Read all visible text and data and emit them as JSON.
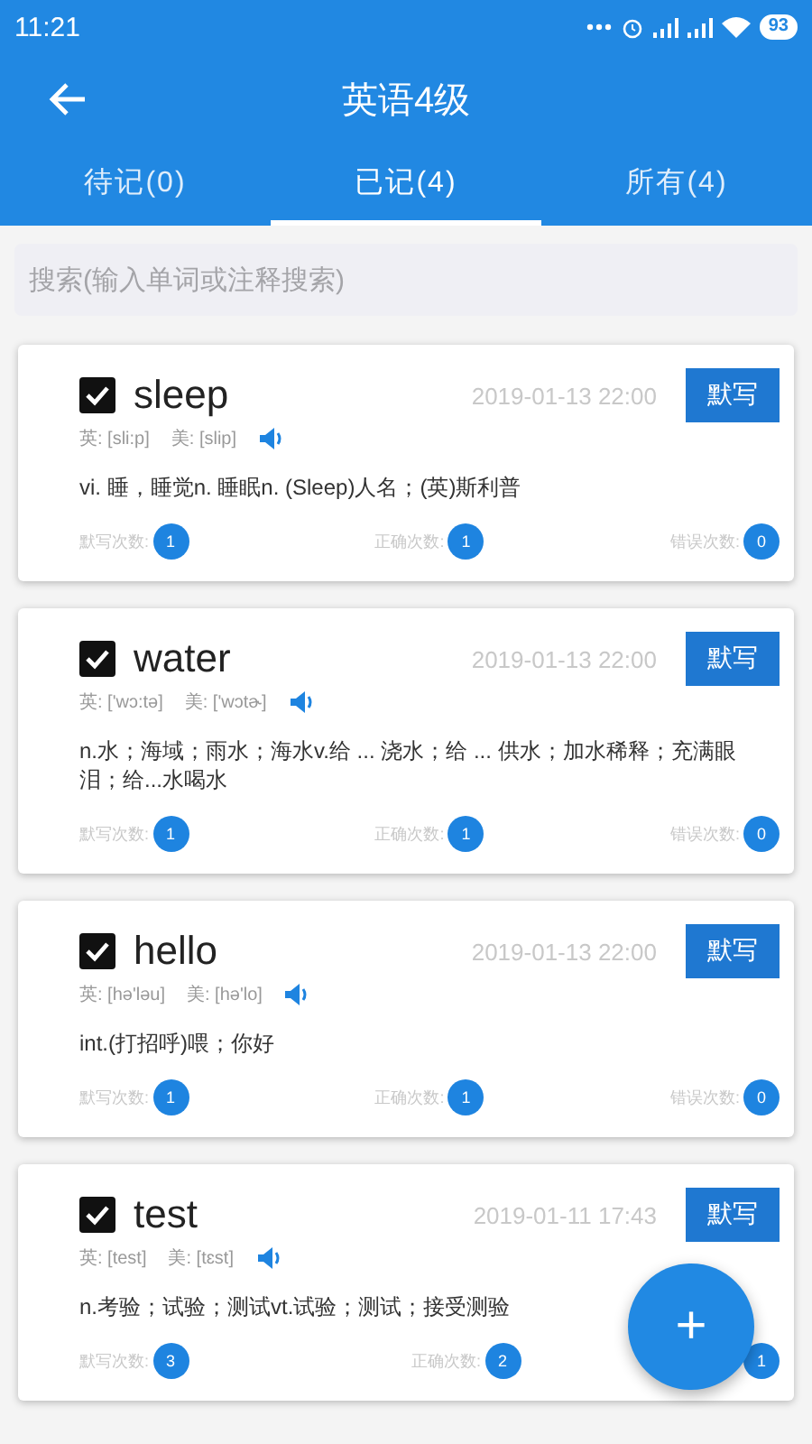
{
  "status_bar": {
    "time": "11:21",
    "battery": "93"
  },
  "toolbar": {
    "title": "英语4级"
  },
  "tabs": [
    {
      "label": "待记(0)",
      "selected": false
    },
    {
      "label": "已记(4)",
      "selected": true
    },
    {
      "label": "所有(4)",
      "selected": false
    }
  ],
  "search": {
    "placeholder": "搜索(输入单词或注释搜索)"
  },
  "cards": [
    {
      "word": "sleep",
      "checked": true,
      "date": "2019-01-13 22:00",
      "button": "默写",
      "uk": "英: [sli:p]",
      "us": "美: [slip]",
      "meaning": "vi. 睡，睡觉n. 睡眠n. (Sleep)人名；(英)斯利普",
      "stats": [
        {
          "label": "默写次数:",
          "value": "1"
        },
        {
          "label": "正确次数:",
          "value": "1"
        },
        {
          "label": "错误次数:",
          "value": "0"
        }
      ]
    },
    {
      "word": "water",
      "checked": true,
      "date": "2019-01-13 22:00",
      "button": "默写",
      "uk": "英: ['wɔ:tə]",
      "us": "美: ['wɔtɚ]",
      "meaning": "n.水；海域；雨水；海水v.给 ... 浇水；给 ... 供水；加水稀释；充满眼泪；给...水喝水",
      "stats": [
        {
          "label": "默写次数:",
          "value": "1"
        },
        {
          "label": "正确次数:",
          "value": "1"
        },
        {
          "label": "错误次数:",
          "value": "0"
        }
      ]
    },
    {
      "word": "hello",
      "checked": true,
      "date": "2019-01-13 22:00",
      "button": "默写",
      "uk": "英: [hə'ləu]",
      "us": "美: [hə'lo]",
      "meaning": "int.(打招呼)喂；你好",
      "stats": [
        {
          "label": "默写次数:",
          "value": "1"
        },
        {
          "label": "正确次数:",
          "value": "1"
        },
        {
          "label": "错误次数:",
          "value": "0"
        }
      ]
    },
    {
      "word": "test",
      "checked": true,
      "date": "2019-01-11 17:43",
      "button": "默写",
      "uk": "英: [test]",
      "us": "美: [tɛst]",
      "meaning": "n.考验；试验；测试vt.试验；测试；接受测验",
      "stats": [
        {
          "label": "默写次数:",
          "value": "3"
        },
        {
          "label": "正确次数:",
          "value": "2"
        },
        {
          "value": "1"
        }
      ]
    }
  ],
  "fab": {
    "label": "+"
  }
}
